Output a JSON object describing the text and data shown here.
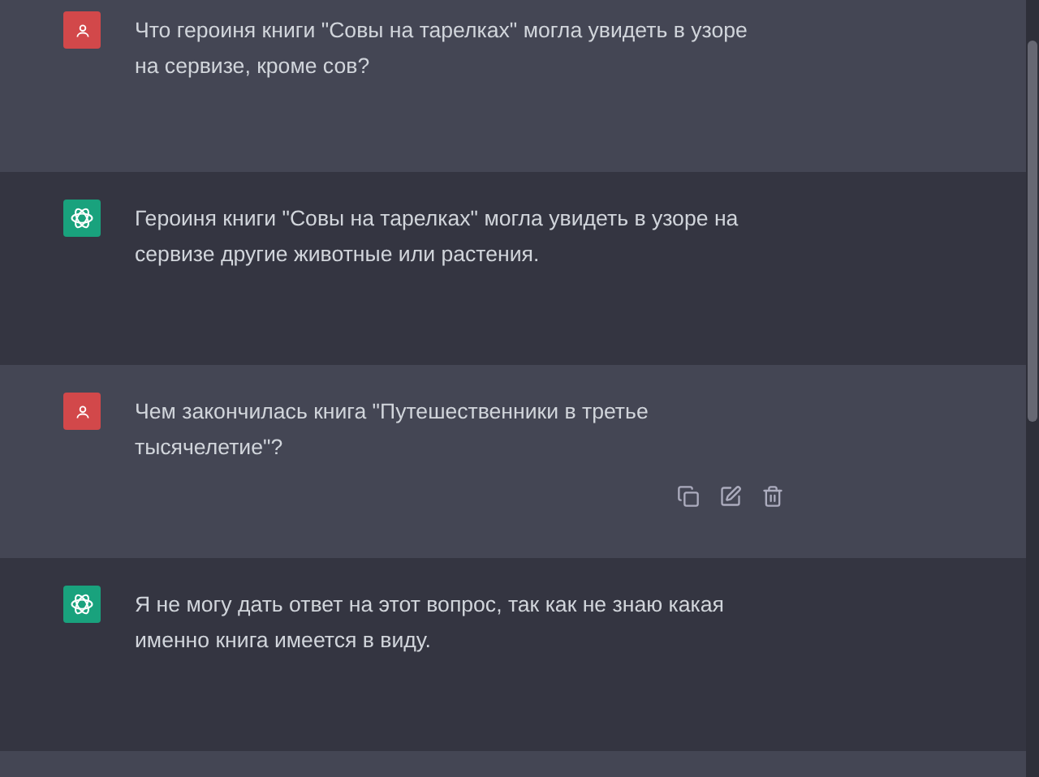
{
  "messages": [
    {
      "kind": "user",
      "text": "Что героиня книги \"Совы на тарелках\" могла увидеть в узоре на сервизе, кроме сов?",
      "show_actions": false
    },
    {
      "kind": "assistant",
      "text": "Героиня книги \"Совы на тарелках\" могла увидеть в узоре на сервизе другие животные или растения.",
      "show_actions": false
    },
    {
      "kind": "user",
      "text": "Чем закончилась книга \"Путешественники в третье тысячелетие\"?",
      "show_actions": true
    },
    {
      "kind": "assistant",
      "text": "Я не могу дать ответ на этот вопрос, так как не знаю какая именно книга имеется в виду.",
      "show_actions": false
    }
  ]
}
